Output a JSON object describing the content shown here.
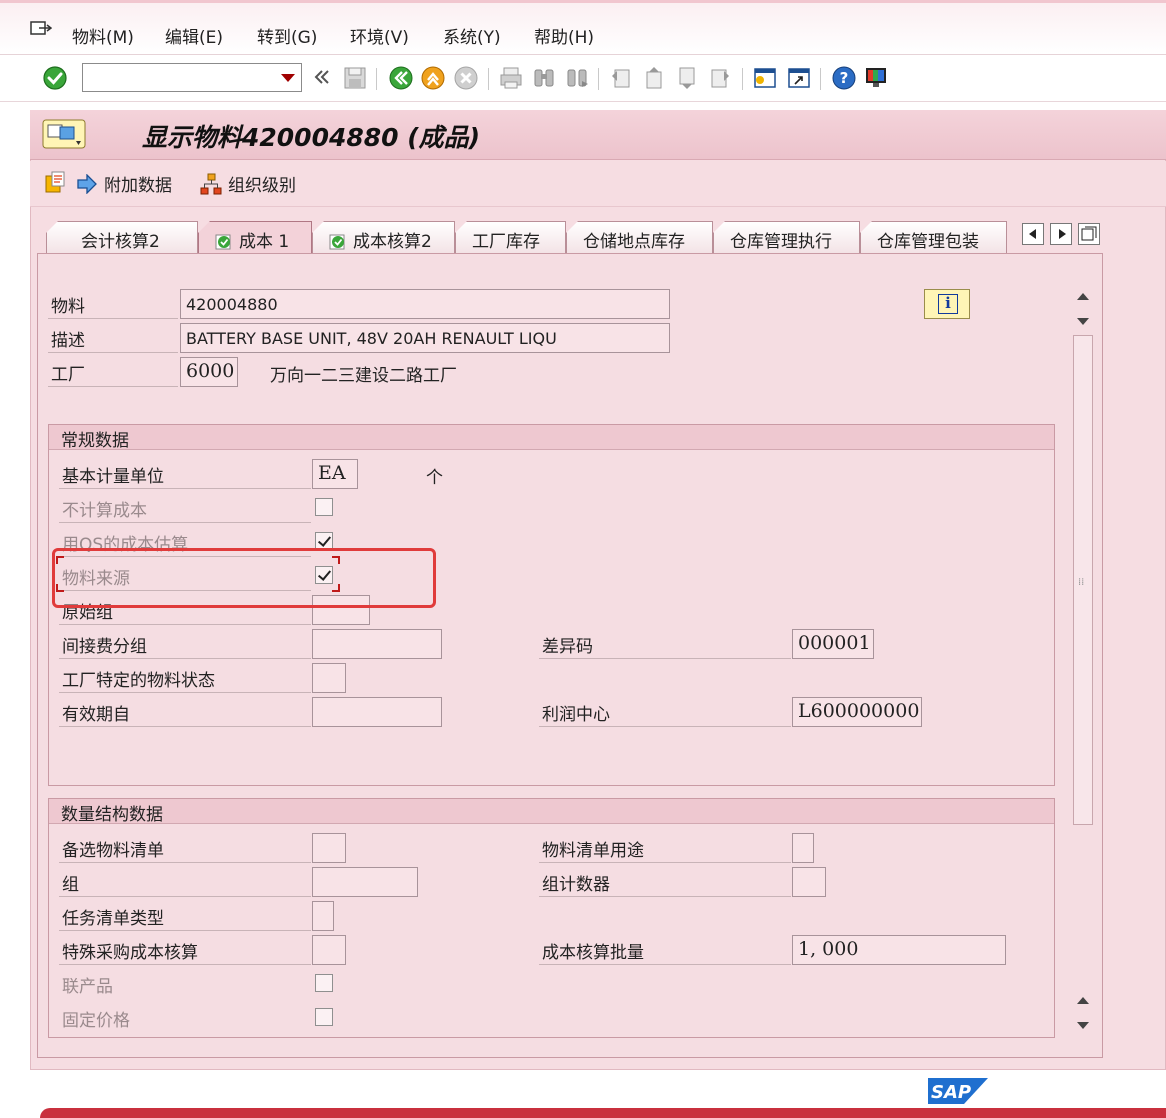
{
  "colors": {
    "sap_red": "#c9303e",
    "frame_pink": "#f6dde2",
    "highlight": "#e03b3b",
    "ok_green": "#3aa63a"
  },
  "menu": [
    {
      "label": "物料(M)"
    },
    {
      "label": "编辑(E)"
    },
    {
      "label": "转到(G)"
    },
    {
      "label": "环境(V)"
    },
    {
      "label": "系统(Y)"
    },
    {
      "label": "帮助(H)"
    }
  ],
  "toolbar": {
    "command_value": "",
    "icons": [
      "enter-icon",
      "save-icon",
      "back-icon",
      "exit-icon",
      "cancel-icon",
      "print-icon",
      "find-icon",
      "find-next-icon",
      "first-page-icon",
      "prev-page-icon",
      "next-page-icon",
      "last-page-icon",
      "create-session-icon",
      "shortcut-icon",
      "help-icon",
      "layout-icon"
    ]
  },
  "title": "显示物料420004880 (成品)",
  "app_toolbar": {
    "additional_data": "附加数据",
    "org_levels": "组织级别"
  },
  "tabs": [
    {
      "label": "会计核算2",
      "active": false,
      "check": false
    },
    {
      "label": "成本 1",
      "active": true,
      "check": true
    },
    {
      "label": "成本核算2",
      "active": false,
      "check": true
    },
    {
      "label": "工厂库存",
      "active": false,
      "check": false
    },
    {
      "label": "仓储地点库存",
      "active": false,
      "check": false
    },
    {
      "label": "仓库管理执行",
      "active": false,
      "check": false
    },
    {
      "label": "仓库管理包装",
      "active": false,
      "check": false
    }
  ],
  "header_fields": {
    "material_label": "物料",
    "material_value": "420004880",
    "desc_label": "描述",
    "desc_value": "BATTERY BASE UNIT, 48V 20AH RENAULT LIQU",
    "plant_label": "工厂",
    "plant_value": "6000",
    "plant_name": "万向一二三建设二路工厂"
  },
  "general": {
    "title": "常规数据",
    "base_uom_label": "基本计量单位",
    "base_uom_value": "EA",
    "base_uom_text": "个",
    "no_costing_label": "不计算成本",
    "no_costing": false,
    "os_estimate_label": "用QS的成本估算",
    "os_estimate": true,
    "mat_origin_label": "物料来源",
    "mat_origin": true,
    "origin_group_label": "原始组",
    "origin_group_value": "",
    "overhead_group_label": "间接费分组",
    "overhead_group_value": "",
    "variance_key_label": "差异码",
    "variance_key_value": "000001",
    "plant_status_label": "工厂特定的物料状态",
    "plant_status_value": "",
    "valid_from_label": "有效期自",
    "valid_from_value": "",
    "profit_center_label": "利润中心",
    "profit_center_value": "L600000000"
  },
  "quantity": {
    "title": "数量结构数据",
    "alt_bom_label": "备选物料清单",
    "alt_bom_value": "",
    "bom_usage_label": "物料清单用途",
    "bom_usage_value": "",
    "group_label": "组",
    "group_value": "",
    "group_counter_label": "组计数器",
    "group_counter_value": "",
    "task_list_type_label": "任务清单类型",
    "task_list_type_value": "",
    "special_proc_label": "特殊采购成本核算",
    "special_proc_value": "",
    "lot_size_label": "成本核算批量",
    "lot_size_value": "1, 000",
    "coproduct_label": "联产品",
    "coproduct": false,
    "fixed_price_label": "固定价格",
    "fixed_price": false
  }
}
